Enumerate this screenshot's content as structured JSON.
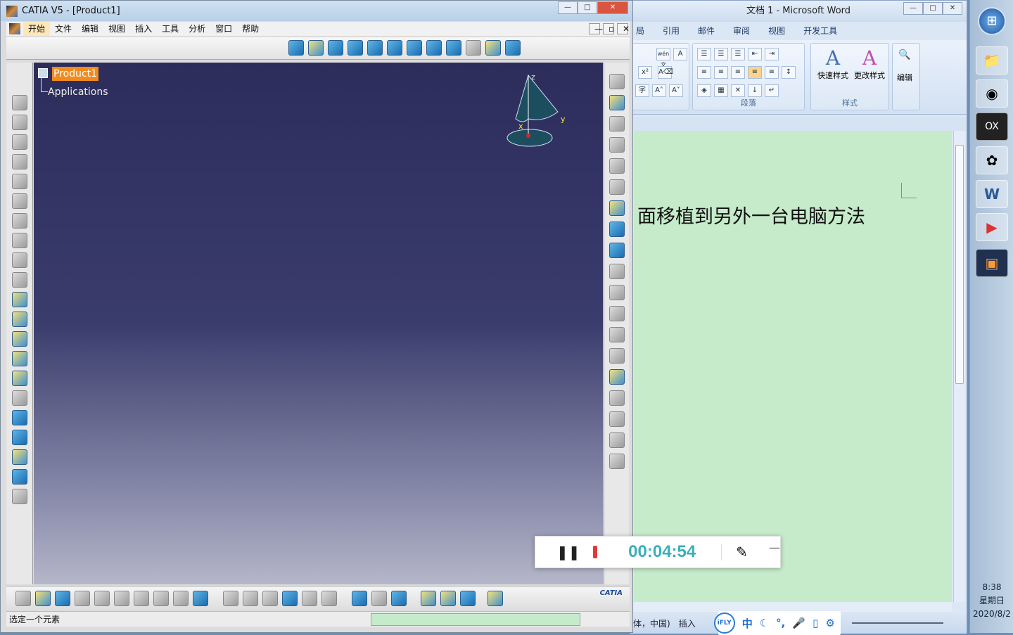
{
  "word": {
    "title": "文档 1 - Microsoft Word",
    "window_buttons": [
      "—",
      "□",
      "✕"
    ],
    "tabs": [
      "局",
      "引用",
      "邮件",
      "审阅",
      "视图",
      "开发工具"
    ],
    "ribbon": {
      "font_buttons": [
        "wén文",
        "A",
        "x²",
        "A⌫",
        "字",
        "A˄",
        "A˅"
      ],
      "paragraph_label": "段落",
      "styles_label": "样式",
      "quick_styles": "快速样式",
      "change_styles": "更改样式",
      "edit": "编辑"
    },
    "document_text": "面移植到另外一台电脑方法",
    "status": {
      "language": "体，中国)",
      "mode": "插入",
      "ime": [
        "中",
        "☾",
        "°,",
        "🎤",
        "▯",
        "⚙"
      ],
      "ime_logo": "iFLY"
    }
  },
  "taskbar": {
    "time": "8:38",
    "weekday": "星期日",
    "date": "2020/8/2",
    "start": "⊞",
    "apps": [
      "📁",
      "◉",
      "OX",
      "✿",
      "W",
      "▶",
      "▣"
    ]
  },
  "catia": {
    "title": "CATIA V5 - [Product1]",
    "window_buttons": [
      "—",
      "□",
      "✕"
    ],
    "mdi_buttons": [
      "—",
      "▫",
      "✕"
    ],
    "menu": [
      "开始",
      "文件",
      "编辑",
      "视图",
      "插入",
      "工具",
      "分析",
      "窗口",
      "帮助"
    ],
    "tree": {
      "root": "Product1",
      "child": "Applications"
    },
    "compass": {
      "z": "z",
      "y": "y",
      "x": "x"
    },
    "status_text": "选定一个元素",
    "logo": "CATIA"
  },
  "recorder": {
    "pause": "❚❚",
    "time": "00:04:54",
    "pen": "✎",
    "minimize": "—"
  }
}
